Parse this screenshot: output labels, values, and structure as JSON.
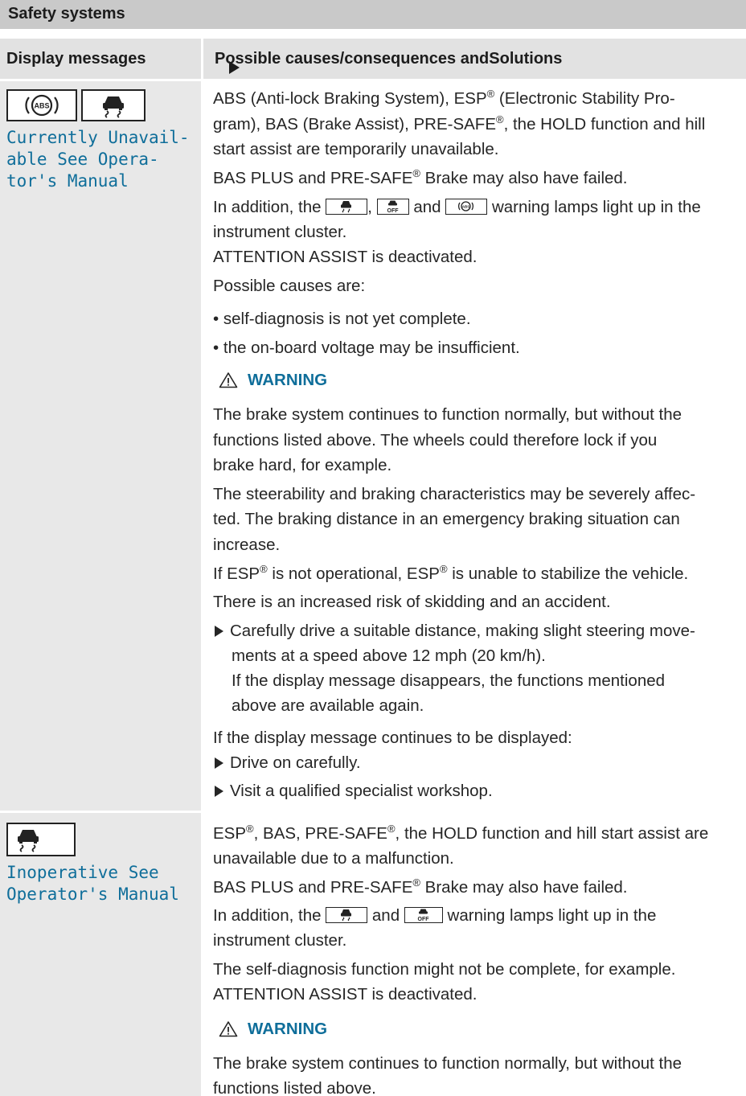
{
  "section_title": "Safety systems",
  "columns": {
    "left": "Display messages",
    "right_a": "Possible causes/consequences and",
    "right_b": "Solutions"
  },
  "icons": [
    "abs-warning-icon",
    "esp-warning-icon",
    "esp-off-icon"
  ],
  "colors": {
    "message_text": "#0f6e9a",
    "warning_text": "#0f6e9a",
    "header_bg": "#c9c9c9",
    "left_cell_bg": "#e8e8e8"
  },
  "row1": {
    "msg_lines": [
      "Currently Unavail-",
      "able See Opera-",
      "tor's Manual"
    ],
    "l1": "ABS (Anti-lock Braking System), ESP® (Electronic Stability Pro-",
    "l2": "gram), BAS (Brake Assist), PRE-SAFE®, the HOLD function and hill",
    "l3": "start assist are temporarily unavailable.",
    "l4": "BAS PLUS and PRE-SAFE® Brake may also have failed.",
    "l5a": "In addition, the",
    "l5b": ",",
    "l5c": "and",
    "l5d": "warning lamps light up in the",
    "l6": "instrument cluster.",
    "l7": "ATTENTION ASSIST is deactivated.",
    "l8": "Possible causes are:",
    "b1": "• self-diagnosis is not yet complete.",
    "b2": "• the on-board voltage may be insufficient.",
    "warning_label": "WARNING",
    "w1": "The brake system continues to function normally, but without the",
    "w2": "functions listed above. The wheels could therefore lock if you",
    "w3": "brake hard, for example.",
    "w4": "The steerability and braking characteristics may be severely affec-",
    "w5": "ted. The braking distance in an emergency braking situation can",
    "w6": "increase.",
    "w7": "If ESP® is not operational, ESP® is unable to stabilize the vehicle.",
    "w8": "There is an increased risk of skidding and an accident.",
    "s1": "Carefully drive a suitable distance, making slight steering move-",
    "s2": "ments at a speed above 12 mph (20 km/h).",
    "s3": "If the display message disappears, the functions mentioned",
    "s4": "above are available again.",
    "c1": "If the display message continues to be displayed:",
    "c2": "Drive on carefully.",
    "c3": "Visit a qualified specialist workshop."
  },
  "row2": {
    "msg_lines": [
      "Inoperative See",
      "Operator's Manual"
    ],
    "l1": "ESP®, BAS, PRE-SAFE®, the HOLD function and hill start assist are",
    "l2": "unavailable due to a malfunction.",
    "l3": "BAS PLUS and PRE-SAFE® Brake may also have failed.",
    "l4a": "In addition, the",
    "l4b": "and",
    "l4c": "warning lamps light up in the",
    "l5": "instrument cluster.",
    "l6": "The self-diagnosis function might not be complete, for example.",
    "l7": "ATTENTION ASSIST is deactivated.",
    "warning_label": "WARNING",
    "w1": "The brake system continues to function normally, but without the",
    "w2": "functions listed above."
  }
}
